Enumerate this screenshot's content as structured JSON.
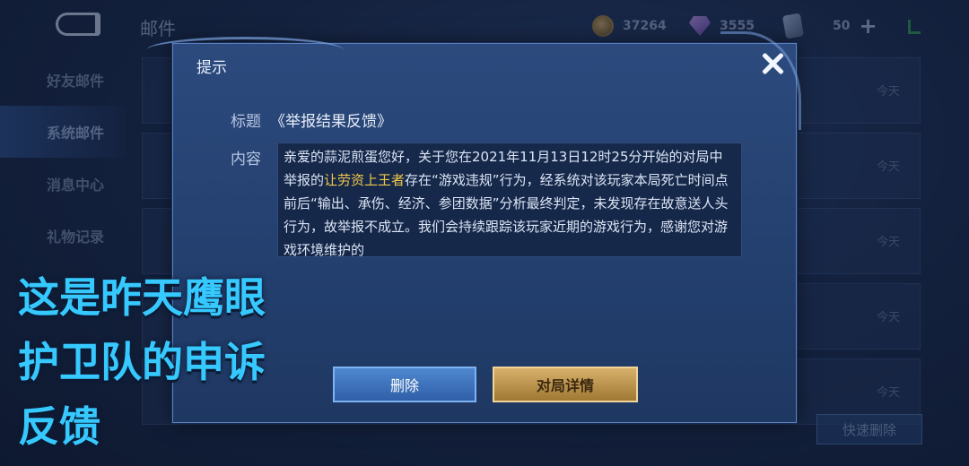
{
  "header": {
    "title": "邮件",
    "gold": "37264",
    "diamonds": "3555",
    "tickets": "50"
  },
  "tabs": [
    {
      "label": "好友邮件"
    },
    {
      "label": "系统邮件"
    },
    {
      "label": "消息中心"
    },
    {
      "label": "礼物记录"
    }
  ],
  "mail_list": {
    "dates": [
      "今天",
      "今天",
      "今天",
      "今天",
      "今天"
    ],
    "quick_delete_label": "快速删除"
  },
  "dialog": {
    "title": "提示",
    "subject_label": "标题",
    "subject": "《举报结果反馈》",
    "content_label": "内容",
    "content_part1": "亲爱的蒜泥煎蛋您好，关于您在2021年11月13日12时25分开始的对局中举报的",
    "content_highlight": "让劳资上王者",
    "content_part2": "存在“游戏违规”行为，经系统对该玩家本局死亡时间点前后“输出、承伤、经济、参团数据”分析最终判定，未发现存在故意送人头行为，故举报不成立。我们会持续跟踪该玩家近期的游戏行为，感谢您对游戏环境维护的",
    "delete_label": "删除",
    "detail_label": "对局详情"
  },
  "caption": [
    "这是昨天鹰眼",
    "护卫队的申诉",
    "反馈"
  ],
  "colors": {
    "highlight": "#f0c84a",
    "caption": "#36c9ff"
  }
}
